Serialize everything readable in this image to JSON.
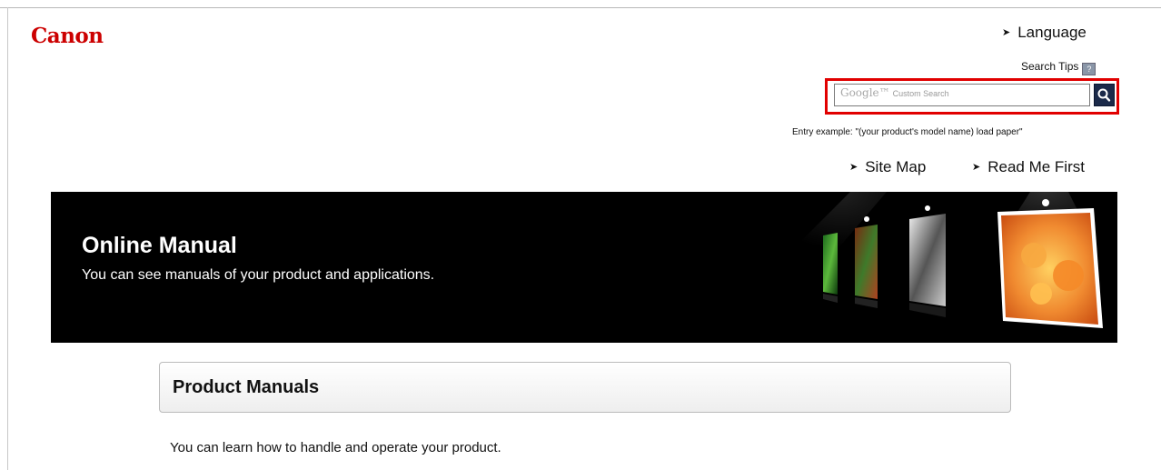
{
  "header": {
    "logo_text": "Canon",
    "language_label": "Language",
    "search_tips_label": "Search Tips",
    "search_placeholder_brand": "Google™",
    "search_placeholder_text": "Custom Search",
    "entry_example": "Entry example: \"(your product's model name) load paper\"",
    "links": {
      "site_map": "Site Map",
      "read_me_first": "Read Me First"
    },
    "highlight_color": "#e10000"
  },
  "banner": {
    "title": "Online Manual",
    "subtitle": "You can see manuals of your product and applications."
  },
  "product_manuals": {
    "heading": "Product Manuals",
    "description": "You can learn how to handle and operate your product."
  },
  "icons": {
    "arrow": "arrow-right-icon",
    "search": "magnifier-icon",
    "help": "question-icon"
  },
  "colors": {
    "brand": "#cc0000",
    "banner_bg": "#000000",
    "search_button": "#1b2a4a"
  }
}
